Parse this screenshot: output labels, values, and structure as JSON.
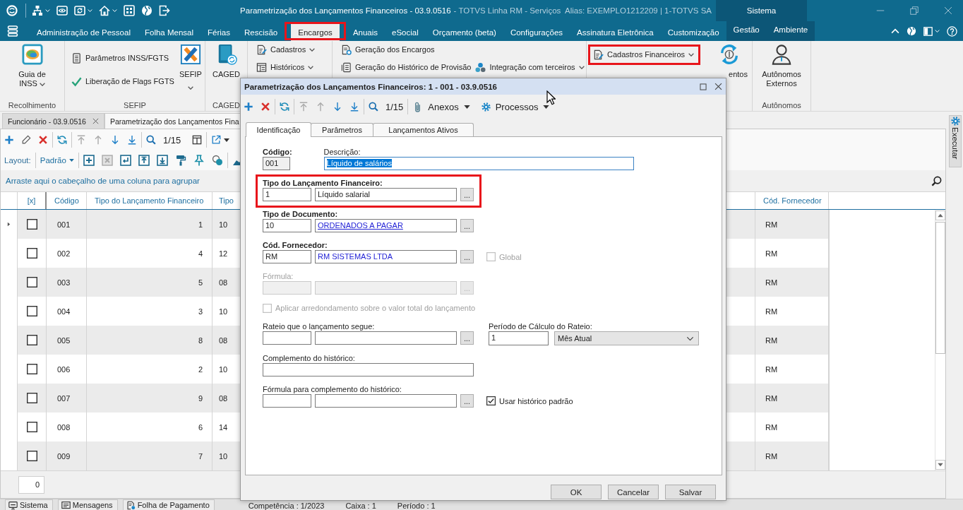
{
  "title_bar": {
    "title": "Parametrização dos Lançamentos Financeiros - 03.9.0516",
    "subtitle": "- TOTVS Linha RM - Serviços  Alias: EXEMPLO1212209 | 1-TOTVS SA",
    "context_group": "Sistema"
  },
  "menu": [
    {
      "label": "Administração de Pessoal",
      "selected": false,
      "contextual": false,
      "highlighted": false
    },
    {
      "label": "Folha Mensal",
      "selected": false,
      "contextual": false,
      "highlighted": false
    },
    {
      "label": "Férias",
      "selected": false,
      "contextual": false,
      "highlighted": false
    },
    {
      "label": "Rescisão",
      "selected": false,
      "contextual": false,
      "highlighted": false
    },
    {
      "label": "Encargos",
      "selected": true,
      "contextual": false,
      "highlighted": true
    },
    {
      "label": "Anuais",
      "selected": false,
      "contextual": false,
      "highlighted": false
    },
    {
      "label": "eSocial",
      "selected": false,
      "contextual": false,
      "highlighted": false
    },
    {
      "label": "Orçamento (beta)",
      "selected": false,
      "contextual": false,
      "highlighted": false
    },
    {
      "label": "Configurações",
      "selected": false,
      "contextual": false,
      "highlighted": false
    },
    {
      "label": "Assinatura Eletrônica",
      "selected": false,
      "contextual": false,
      "highlighted": false
    },
    {
      "label": "Customização",
      "selected": false,
      "contextual": false,
      "highlighted": false
    },
    {
      "label": "Gestão",
      "selected": false,
      "contextual": true,
      "highlighted": false
    },
    {
      "label": "Ambiente",
      "selected": false,
      "contextual": true,
      "highlighted": false
    }
  ],
  "ribbon": {
    "groups": [
      {
        "label": "Recolhimento",
        "items": [
          {
            "kind": "large",
            "label": "Guia de INSS",
            "dropdown": true,
            "highlighted": false
          }
        ]
      },
      {
        "label": "SEFIP",
        "items": [
          {
            "kind": "small",
            "label": "Parâmetros INSS/FGTS",
            "dropdown": false,
            "highlighted": false
          },
          {
            "kind": "small",
            "label": "Liberação de Flags FGTS",
            "dropdown": false,
            "highlighted": false
          },
          {
            "kind": "large",
            "label": "SEFIP",
            "dropdown": true,
            "highlighted": false
          }
        ]
      },
      {
        "label": "CAGED",
        "items": [
          {
            "kind": "large",
            "label": "CAGED",
            "dropdown": false,
            "highlighted": false
          }
        ]
      },
      {
        "items": [
          {
            "kind": "small",
            "label": "Cadastros",
            "dropdown": true,
            "highlighted": false
          },
          {
            "kind": "small",
            "label": "Históricos",
            "dropdown": true,
            "highlighted": false
          }
        ]
      },
      {
        "items": [
          {
            "kind": "small",
            "label": "Geração dos Encargos",
            "dropdown": false,
            "highlighted": false
          },
          {
            "kind": "small",
            "label": "Geração do Histórico de Provisão",
            "dropdown": false,
            "highlighted": false
          },
          {
            "kind": "small",
            "label": "Integração com terceiros",
            "dropdown": true,
            "highlighted": false
          }
        ]
      },
      {
        "items": [
          {
            "kind": "small",
            "label": "Cadastros Financeiros",
            "dropdown": true,
            "highlighted": true
          },
          {
            "kind": "large",
            "label": "entos",
            "dropdown": false,
            "highlighted": false
          }
        ]
      },
      {
        "label": "Autônomos",
        "items": [
          {
            "kind": "large",
            "label": "Autônomos Externos",
            "dropdown": false,
            "highlighted": false
          }
        ]
      }
    ]
  },
  "documents": [
    {
      "label": "Funcionário - 03.9.0516",
      "selected": false,
      "closable": true
    },
    {
      "label": "Parametrização dos Lançamentos Fina",
      "selected": true,
      "closable": false
    }
  ],
  "toolbar": [
    [
      {
        "kind": "add",
        "disabled": false
      },
      {
        "kind": "edit",
        "disabled": false
      },
      {
        "kind": "delete",
        "disabled": false
      }
    ],
    [
      {
        "kind": "refresh",
        "disabled": false
      }
    ],
    [
      {
        "kind": "first",
        "disabled": true
      },
      {
        "kind": "previous",
        "disabled": true
      },
      {
        "kind": "next",
        "disabled": false
      },
      {
        "kind": "last",
        "disabled": false
      }
    ],
    [
      {
        "kind": "search",
        "disabled": false
      },
      {
        "kind": "position",
        "text": "1/15",
        "disabled": false
      },
      {
        "kind": "columns",
        "disabled": false
      }
    ],
    [
      {
        "kind": "export",
        "disabled": false
      }
    ]
  ],
  "layout_bar": [
    [
      {
        "kind": "label",
        "text": "Layout:",
        "disabled": false
      }
    ],
    [
      {
        "kind": "layout_select",
        "text": "Padrão",
        "disabled": false
      }
    ],
    [
      {
        "kind": "plus_box",
        "disabled": false
      },
      {
        "kind": "x_box",
        "disabled": true
      },
      {
        "kind": "enter_box",
        "disabled": false
      },
      {
        "kind": "upload_box",
        "disabled": false
      },
      {
        "kind": "download_box",
        "disabled": false
      },
      {
        "kind": "roller",
        "disabled": false
      },
      {
        "kind": "pin",
        "disabled": false
      },
      {
        "kind": "circles",
        "disabled": false
      }
    ],
    [
      {
        "kind": "chart",
        "disabled": false
      }
    ]
  ],
  "group_panel": {
    "hint": "Arraste aqui o cabeçalho de uma coluna para agrupar"
  },
  "table": {
    "checkbox_header": "[x]",
    "columns": [
      "Código",
      "Tipo do Lançamento Financeiro",
      "Tipo",
      "Cód. Fornecedor"
    ],
    "rows": [
      {
        "selected": true,
        "checked": false,
        "cells": [
          "001",
          "1",
          "10",
          "RM"
        ]
      },
      {
        "selected": false,
        "checked": false,
        "cells": [
          "002",
          "4",
          "12",
          "RM"
        ]
      },
      {
        "selected": false,
        "checked": false,
        "cells": [
          "003",
          "5",
          "08",
          "RM"
        ]
      },
      {
        "selected": false,
        "checked": false,
        "cells": [
          "004",
          "3",
          "10",
          "RM"
        ]
      },
      {
        "selected": false,
        "checked": false,
        "cells": [
          "005",
          "8",
          "08",
          "RM"
        ]
      },
      {
        "selected": false,
        "checked": false,
        "cells": [
          "006",
          "2",
          "10",
          "RM"
        ]
      },
      {
        "selected": false,
        "checked": false,
        "cells": [
          "007",
          "9",
          "08",
          "RM"
        ]
      },
      {
        "selected": false,
        "checked": false,
        "cells": [
          "008",
          "6",
          "14",
          "RM"
        ]
      },
      {
        "selected": false,
        "checked": false,
        "cells": [
          "009",
          "7",
          "10",
          "RM"
        ]
      }
    ],
    "footer": "0"
  },
  "side_panel": {
    "tab": "Executar"
  },
  "status_bar": {
    "tabs": [
      "Sistema",
      "Mensagens",
      "Folha de Pagamento"
    ],
    "fields": [
      "Competência : 1/2023",
      "Caixa : 1",
      "Período : 1"
    ]
  },
  "dialog": {
    "title": "Parametrização dos Lançamentos Financeiros: 1 - 001 - 03.9.0516",
    "toolbar": [
      [
        {
          "kind": "add",
          "disabled": false
        },
        {
          "kind": "delete",
          "disabled": false
        }
      ],
      [
        {
          "kind": "refresh",
          "disabled": false
        }
      ],
      [
        {
          "kind": "first",
          "disabled": true
        },
        {
          "kind": "previous",
          "disabled": true
        },
        {
          "kind": "next",
          "disabled": false
        },
        {
          "kind": "last",
          "disabled": false
        }
      ],
      [
        {
          "kind": "search",
          "disabled": false
        },
        {
          "kind": "position",
          "text": "1/15",
          "disabled": false
        }
      ],
      [
        {
          "kind": "attachments",
          "text": "Anexos",
          "disabled": false
        },
        {
          "kind": "processes",
          "text": "Processos",
          "disabled": false
        }
      ]
    ],
    "tabs": [
      {
        "label": "Identificação",
        "selected": true
      },
      {
        "label": "Parâmetros",
        "selected": false
      },
      {
        "label": "Lançamentos Ativos",
        "selected": false
      }
    ],
    "form": [
      {
        "highlighted": false,
        "items": [
          {
            "kind": "code",
            "label": "Código:",
            "value": "001",
            "required": true,
            "readonly": true,
            "focused": false,
            "disabled": false
          },
          {
            "kind": "text",
            "label": "Descrição:",
            "value": "Líquido de salários",
            "required": false,
            "readonly": false,
            "focused": true,
            "disabled": false
          }
        ]
      },
      {
        "highlighted": true,
        "items": [
          {
            "kind": "lookup",
            "label": "Tipo do Lançamento Financeiro:",
            "code": "1",
            "description": "Líquido salarial",
            "button": "...",
            "required": true,
            "disabled": false,
            "link": false,
            "underlined": false
          }
        ]
      },
      {
        "highlighted": false,
        "items": [
          {
            "kind": "lookup",
            "label": "Tipo de Documento:",
            "code": "10",
            "description": "ORDENADOS A PAGAR",
            "button": "...",
            "required": true,
            "disabled": false,
            "link": true,
            "underlined": true
          }
        ]
      },
      {
        "highlighted": false,
        "items": [
          {
            "kind": "lookup",
            "label": "Cód. Fornecedor:",
            "code": "RM",
            "description": "RM SISTEMAS LTDA",
            "button": "...",
            "required": true,
            "disabled": false,
            "link": true,
            "underlined": false
          },
          {
            "kind": "checkbox",
            "label": "Global",
            "checked": false,
            "disabled": true
          }
        ]
      },
      {
        "highlighted": false,
        "items": [
          {
            "kind": "lookup",
            "label": "Fórmula:",
            "button": "...",
            "required": false,
            "disabled": true
          }
        ]
      },
      {
        "highlighted": false,
        "items": [
          {
            "kind": "checkbox",
            "label": "Aplicar arredondamento sobre o valor total do lançamento",
            "checked": false,
            "disabled": true
          }
        ]
      },
      {
        "highlighted": false,
        "items": [
          {
            "kind": "lookup",
            "label": "Rateio que o lançamento segue:",
            "button": "...",
            "required": false,
            "disabled": false
          },
          {
            "kind": "period",
            "label": "Período de Cálculo do Rateio:",
            "value": "1",
            "option": "Mês Atual",
            "required": false,
            "disabled": false
          }
        ]
      },
      {
        "highlighted": false,
        "items": [
          {
            "kind": "text",
            "label": "Complemento do histórico:",
            "required": false,
            "readonly": false,
            "focused": false,
            "disabled": false
          }
        ]
      },
      {
        "highlighted": false,
        "items": [
          {
            "kind": "lookup",
            "label": "Fórmula para complemento do histórico:",
            "button": "...",
            "required": false,
            "disabled": false
          },
          {
            "kind": "checkbox",
            "label": "Usar histórico padrão",
            "checked": true,
            "disabled": false
          }
        ]
      }
    ],
    "buttons": [
      "OK",
      "Cancelar",
      "Salvar"
    ]
  }
}
